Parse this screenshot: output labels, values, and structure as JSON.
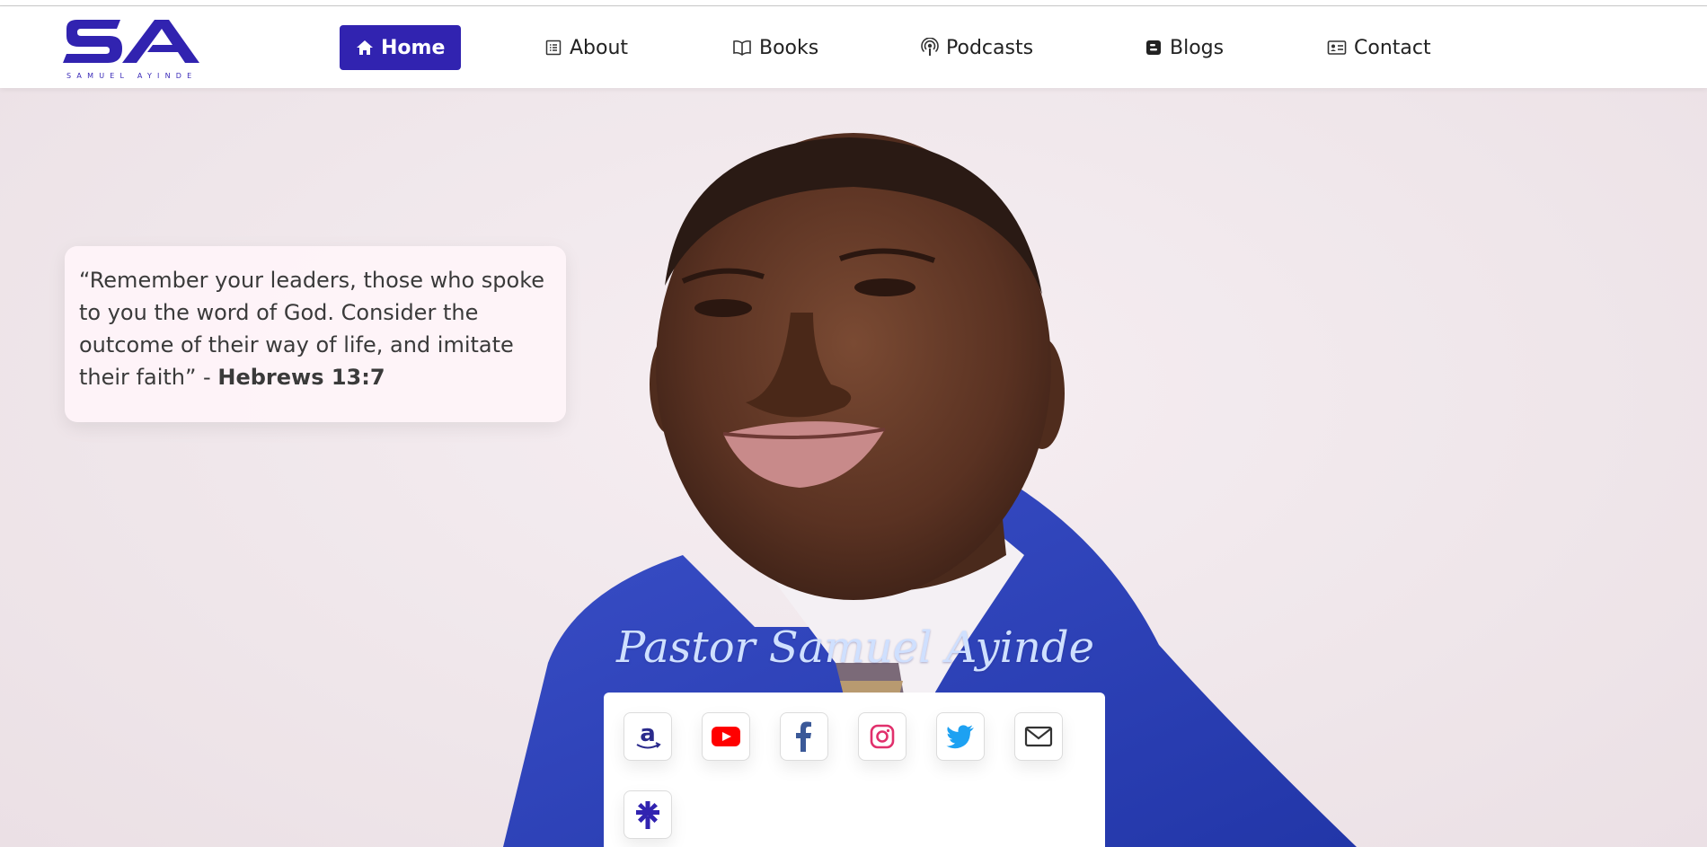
{
  "brand": {
    "initials": "SA",
    "name": "SAMUEL AYINDE",
    "color": "#3123b0"
  },
  "nav": {
    "items": [
      {
        "label": "Home",
        "icon": "home-icon",
        "active": true
      },
      {
        "label": "About",
        "icon": "list-doc-icon",
        "active": false
      },
      {
        "label": "Books",
        "icon": "open-book-icon",
        "active": false
      },
      {
        "label": "Podcasts",
        "icon": "podcast-icon",
        "active": false
      },
      {
        "label": "Blogs",
        "icon": "blogger-icon",
        "active": false
      },
      {
        "label": "Contact",
        "icon": "contact-card-icon",
        "active": false
      }
    ]
  },
  "quote": {
    "text": "“Remember your leaders, those who spoke to you the word of God. Consider the outcome of their way of life, and imitate their faith” - ",
    "reference": "Hebrews 13:7"
  },
  "hero": {
    "name": "Pastor Samuel Ayinde"
  },
  "social": {
    "links": [
      {
        "icon": "amazon-icon",
        "color": "#2a2a8c"
      },
      {
        "icon": "youtube-icon",
        "color": "#ff0000"
      },
      {
        "icon": "facebook-icon",
        "color": "#3b5998"
      },
      {
        "icon": "instagram-icon",
        "color": "#e1306c"
      },
      {
        "icon": "twitter-icon",
        "color": "#1da1f2"
      },
      {
        "icon": "mail-icon",
        "color": "#333333"
      },
      {
        "icon": "linktree-icon",
        "color": "#3123b0"
      }
    ]
  }
}
